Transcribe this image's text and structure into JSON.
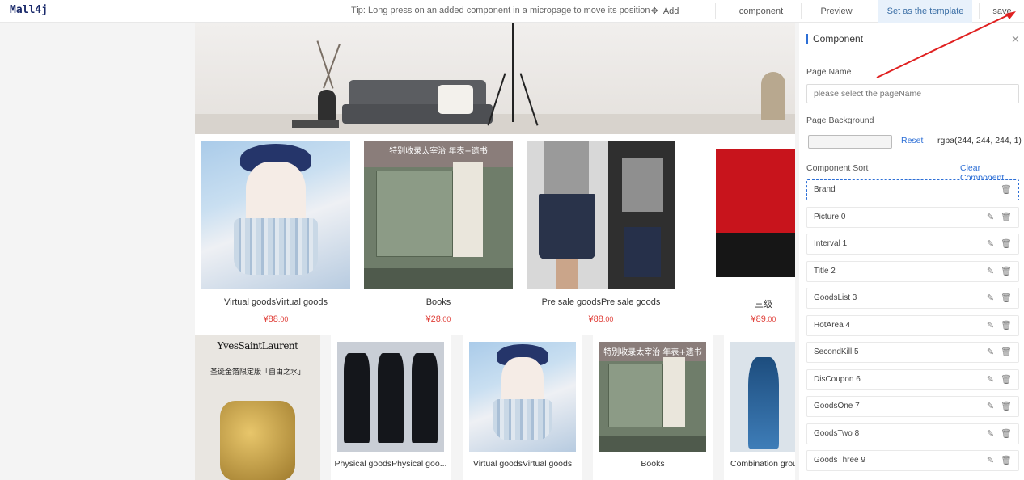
{
  "topbar": {
    "logo": "Mall4j",
    "tip": "Tip: Long press on an added component in a micropage to move its position",
    "add_component": "Add component",
    "component": "component",
    "preview": "Preview",
    "set_template": "Set as the template",
    "save": "save"
  },
  "goods_row1": [
    {
      "name": "Virtual goodsVirtual goods",
      "currency": "¥",
      "price_int": "88",
      "price_dec": ".00"
    },
    {
      "name": "Books",
      "currency": "¥",
      "price_int": "28",
      "price_dec": ".00"
    },
    {
      "name": "Pre sale goodsPre sale goods",
      "currency": "¥",
      "price_int": "88",
      "price_dec": ".00"
    },
    {
      "name": "三级",
      "currency": "¥",
      "price_int": "89",
      "price_dec": ".00"
    }
  ],
  "goods_row2": [
    {
      "name": ""
    },
    {
      "name": "Physical goodsPhysical goo..."
    },
    {
      "name": "Virtual goodsVirtual goods"
    },
    {
      "name": "Books"
    },
    {
      "name": "Combination grou"
    }
  ],
  "banner_images": {
    "book_ribbon": "特别收录太宰治 年表+遗书",
    "ysl_logo": "YvesSaintLaurent",
    "ysl_sub": "圣诞金箔限定版「自由之水」"
  },
  "panel": {
    "title": "Component",
    "page_name_label": "Page Name",
    "page_name_placeholder": "please select the pageName",
    "page_bg_label": "Page Background",
    "reset": "Reset",
    "bg_value": "rgba(244, 244, 244, 1)",
    "component_sort_label": "Component Sort",
    "clear_component": "Clear Component",
    "components": [
      {
        "label": "Brand",
        "editable": false
      },
      {
        "label": "Picture 0",
        "editable": true
      },
      {
        "label": "Interval 1",
        "editable": true
      },
      {
        "label": "Title 2",
        "editable": true
      },
      {
        "label": "GoodsList 3",
        "editable": true
      },
      {
        "label": "HotArea 4",
        "editable": true
      },
      {
        "label": "SecondKill 5",
        "editable": true
      },
      {
        "label": "DisCoupon 6",
        "editable": true
      },
      {
        "label": "GoodsOne 7",
        "editable": true
      },
      {
        "label": "GoodsTwo 8",
        "editable": true
      },
      {
        "label": "GoodsThree 9",
        "editable": true
      }
    ]
  },
  "colors": {
    "accent": "#2d6fd6",
    "price": "#e0403a",
    "annotation_arrow": "#e02020"
  }
}
